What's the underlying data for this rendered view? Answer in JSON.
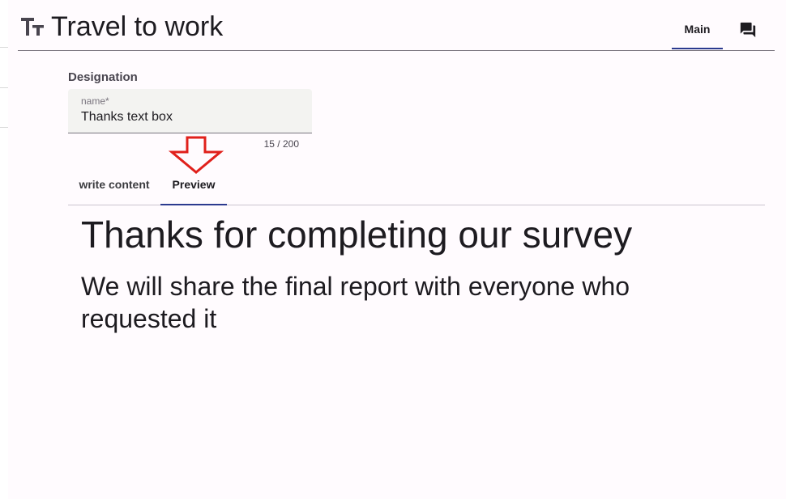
{
  "app": {
    "title": "Travel to work",
    "title_icon": "text-fields-icon"
  },
  "header_tabs": {
    "main_label": "Main",
    "forum_icon": "forum-icon"
  },
  "designation": {
    "section_label": "Designation",
    "field_label": "name*",
    "field_value": "Thanks text box",
    "counter": "15 / 200"
  },
  "content_tabs": {
    "write_label": "write content",
    "preview_label": "Preview",
    "selected": "Preview"
  },
  "preview": {
    "heading": "Thanks for completing our survey",
    "subheading": "We will share the final report with everyone who requested it"
  },
  "colors": {
    "accent": "#2b3a8f",
    "annotation_arrow": "#e0201b",
    "surface": "#fffbfe"
  }
}
